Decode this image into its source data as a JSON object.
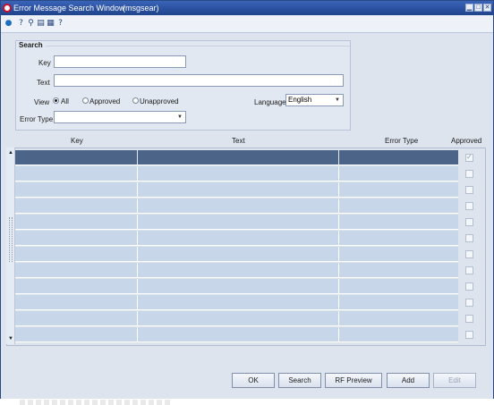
{
  "window": {
    "title": "Error Message Search Window",
    "code": "(msgsear)",
    "controls": {
      "minimize": "▁",
      "maximize": "□",
      "close": "✕"
    }
  },
  "toolbar": {
    "icons": [
      "globe-icon",
      "help-icon",
      "search-icon",
      "document-icon",
      "grid-icon",
      "whats-this-icon"
    ]
  },
  "search": {
    "legend": "Search",
    "key_label": "Key",
    "key_value": "",
    "text_label": "Text",
    "text_value": "",
    "view_label": "View",
    "view_options": [
      "All",
      "Approved",
      "Unapproved"
    ],
    "view_selected": "All",
    "language_label": "Language",
    "language_value": "English",
    "error_type_label": "Error Type",
    "error_type_value": ""
  },
  "table": {
    "columns": [
      "Key",
      "Text",
      "Error Type",
      "Approved"
    ],
    "row_count": 12,
    "selected_row": 0,
    "selected_row_approved": true
  },
  "buttons": {
    "ok": "OK",
    "search": "Search",
    "rf_preview": "RF Preview",
    "add": "Add",
    "edit": "Edit"
  },
  "colors": {
    "titlebar": "#2a4f9e",
    "selected_row": "#4c6488",
    "row": "#c8d6ea",
    "background": "#dde4ee"
  }
}
